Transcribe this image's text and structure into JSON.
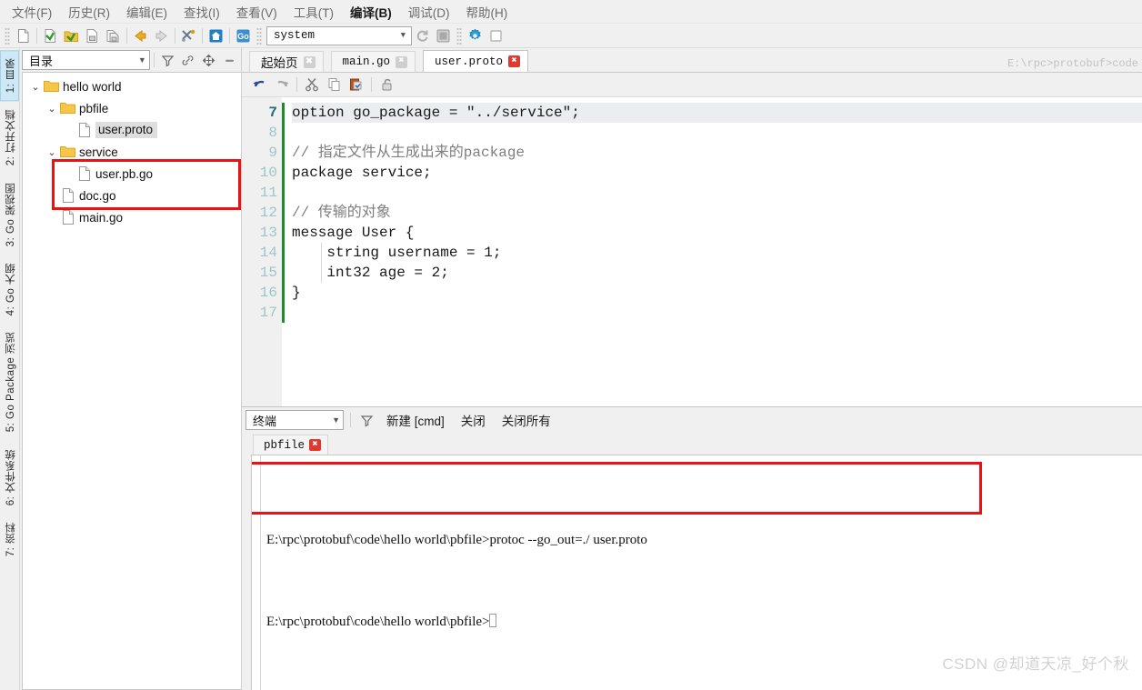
{
  "menubar": {
    "items": [
      {
        "label": "文件(F)",
        "active": false
      },
      {
        "label": "历史(R)",
        "active": false
      },
      {
        "label": "编辑(E)",
        "active": false
      },
      {
        "label": "查找(I)",
        "active": false
      },
      {
        "label": "查看(V)",
        "active": false
      },
      {
        "label": "工具(T)",
        "active": false
      },
      {
        "label": "编译(B)",
        "active": true
      },
      {
        "label": "调试(D)",
        "active": false
      },
      {
        "label": "帮助(H)",
        "active": false
      }
    ]
  },
  "toolbar": {
    "icons": [
      "new-file-icon",
      "open-file-icon",
      "open-folder-icon",
      "save-file-icon",
      "save-all-icon",
      "back-arrow-icon",
      "forward-arrow-icon",
      "tools-icon",
      "home-icon",
      "go-icon"
    ],
    "env_combo_value": "system",
    "right_icons": [
      "refresh-icon",
      "stop-icon",
      "settings-gear-icon",
      "toggle-panel-icon"
    ]
  },
  "vtabs": {
    "items": [
      {
        "label": "1: 目录",
        "selected": true
      },
      {
        "label": "2: 打开文档",
        "selected": false
      },
      {
        "label": "3: Go 架视图",
        "selected": false
      },
      {
        "label": "4: Go 大纲",
        "selected": false
      },
      {
        "label": "5: Go Package 浏览",
        "selected": false
      },
      {
        "label": "6: 文件系统",
        "selected": false
      },
      {
        "label": "7: 资料",
        "selected": false
      }
    ]
  },
  "dirpanel": {
    "combo_value": "目录",
    "header_icons": [
      "filter-icon",
      "link-icon",
      "move-icon",
      "collapse-icon"
    ],
    "tree": [
      {
        "label": "hello world",
        "type": "folder",
        "depth": 0,
        "expanded": true,
        "selected": false
      },
      {
        "label": "pbfile",
        "type": "folder",
        "depth": 1,
        "expanded": true,
        "selected": false
      },
      {
        "label": "user.proto",
        "type": "file",
        "depth": 2,
        "expanded": null,
        "selected": true
      },
      {
        "label": "service",
        "type": "folder",
        "depth": 1,
        "expanded": true,
        "selected": false
      },
      {
        "label": "user.pb.go",
        "type": "file",
        "depth": 2,
        "expanded": null,
        "selected": false
      },
      {
        "label": "doc.go",
        "type": "file",
        "depth": 1,
        "expanded": null,
        "selected": false
      },
      {
        "label": "main.go",
        "type": "file",
        "depth": 1,
        "expanded": null,
        "selected": false
      }
    ]
  },
  "editor": {
    "tabs": [
      {
        "label": "起始页",
        "active": false,
        "close_red": false,
        "cjk": true
      },
      {
        "label": "main.go",
        "active": false,
        "close_red": false,
        "cjk": false
      },
      {
        "label": "user.proto",
        "active": true,
        "close_red": true,
        "cjk": false
      }
    ],
    "close_glyph": "✖",
    "breadcrumb_path": "E:\\rpc>protobuf>code",
    "toolbar_icons": [
      "undo-icon",
      "redo-icon",
      "cut-icon",
      "copy-icon",
      "paste-icon",
      "lock-icon"
    ],
    "first_line_number": 7,
    "current_line": 7,
    "lines": [
      {
        "n": 7,
        "text": "option go_package = \"../service\";",
        "comment": false,
        "highlight": true
      },
      {
        "n": 8,
        "text": "",
        "comment": false,
        "highlight": false
      },
      {
        "n": 9,
        "text": "// 指定文件从生成出来的package",
        "comment": true,
        "highlight": false
      },
      {
        "n": 10,
        "text": "package service;",
        "comment": false,
        "highlight": false
      },
      {
        "n": 11,
        "text": "",
        "comment": false,
        "highlight": false
      },
      {
        "n": 12,
        "text": "// 传输的对象",
        "comment": true,
        "highlight": false
      },
      {
        "n": 13,
        "text": "message User {",
        "comment": false,
        "highlight": false
      },
      {
        "n": 14,
        "text": "    string username = 1;",
        "comment": false,
        "highlight": false
      },
      {
        "n": 15,
        "text": "    int32 age = 2;",
        "comment": false,
        "highlight": false
      },
      {
        "n": 16,
        "text": "}",
        "comment": false,
        "highlight": false
      },
      {
        "n": 17,
        "text": "",
        "comment": false,
        "highlight": false
      }
    ]
  },
  "terminal": {
    "combo_value": "终端",
    "filter_icon": "filter-icon",
    "actions": [
      "新建 [cmd]",
      "关闭",
      "关闭所有"
    ],
    "tabs": [
      {
        "label": "pbfile",
        "close_red": true
      }
    ],
    "close_glyph": "✖",
    "lines": [
      "E:\\rpc\\protobuf\\code\\hello world\\pbfile>protoc --go_out=./ user.proto",
      "E:\\rpc\\protobuf\\code\\hello world\\pbfile>"
    ]
  },
  "annotations": {
    "color": "#ee1111",
    "tree_box_label": "service-folder-highlight",
    "terminal_box_label": "protoc-command-highlight"
  },
  "watermark": "CSDN @却道天凉_好个秋"
}
